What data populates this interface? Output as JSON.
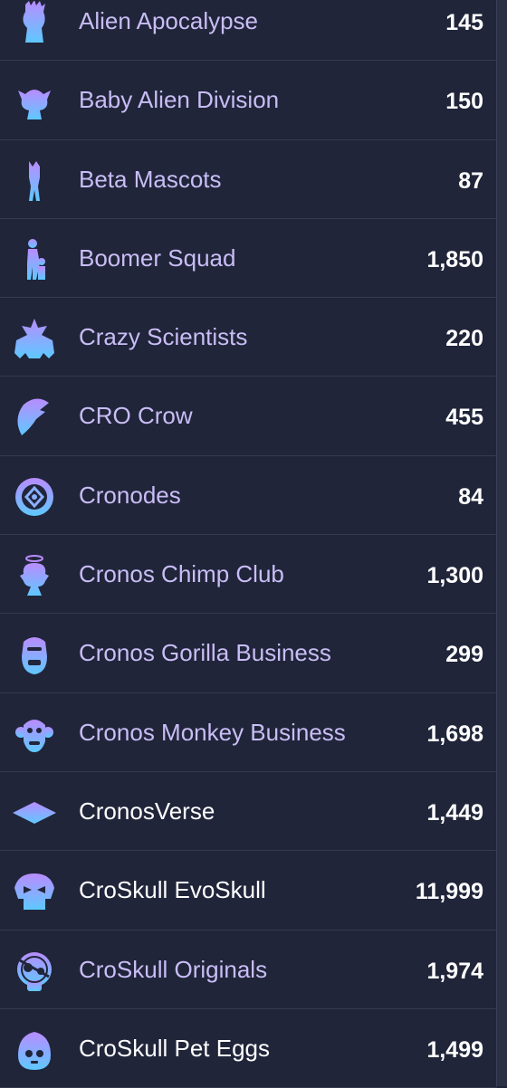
{
  "collections": [
    {
      "name": "Alien Apocalypse",
      "count": "145"
    },
    {
      "name": "Baby Alien Division",
      "count": "150"
    },
    {
      "name": "Beta Mascots",
      "count": "87"
    },
    {
      "name": "Boomer Squad",
      "count": "1,850"
    },
    {
      "name": "Crazy Scientists",
      "count": "220"
    },
    {
      "name": "CRO Crow",
      "count": "455"
    },
    {
      "name": "Cronodes",
      "count": "84"
    },
    {
      "name": "Cronos Chimp Club",
      "count": "1,300"
    },
    {
      "name": "Cronos Gorilla Business",
      "count": "299"
    },
    {
      "name": "Cronos Monkey Business",
      "count": "1,698"
    },
    {
      "name": "CronosVerse",
      "count": "1,449"
    },
    {
      "name": "CroSkull EvoSkull",
      "count": "11,999"
    },
    {
      "name": "CroSkull Originals",
      "count": "1,974"
    },
    {
      "name": "CroSkull Pet Eggs",
      "count": "1,499"
    }
  ],
  "colors": {
    "background": "#20253a",
    "name_text": "#c9bdf5",
    "count_text": "#ffffff",
    "icon_gradient_top": "#b98cff",
    "icon_gradient_bottom": "#5ec8ff"
  }
}
